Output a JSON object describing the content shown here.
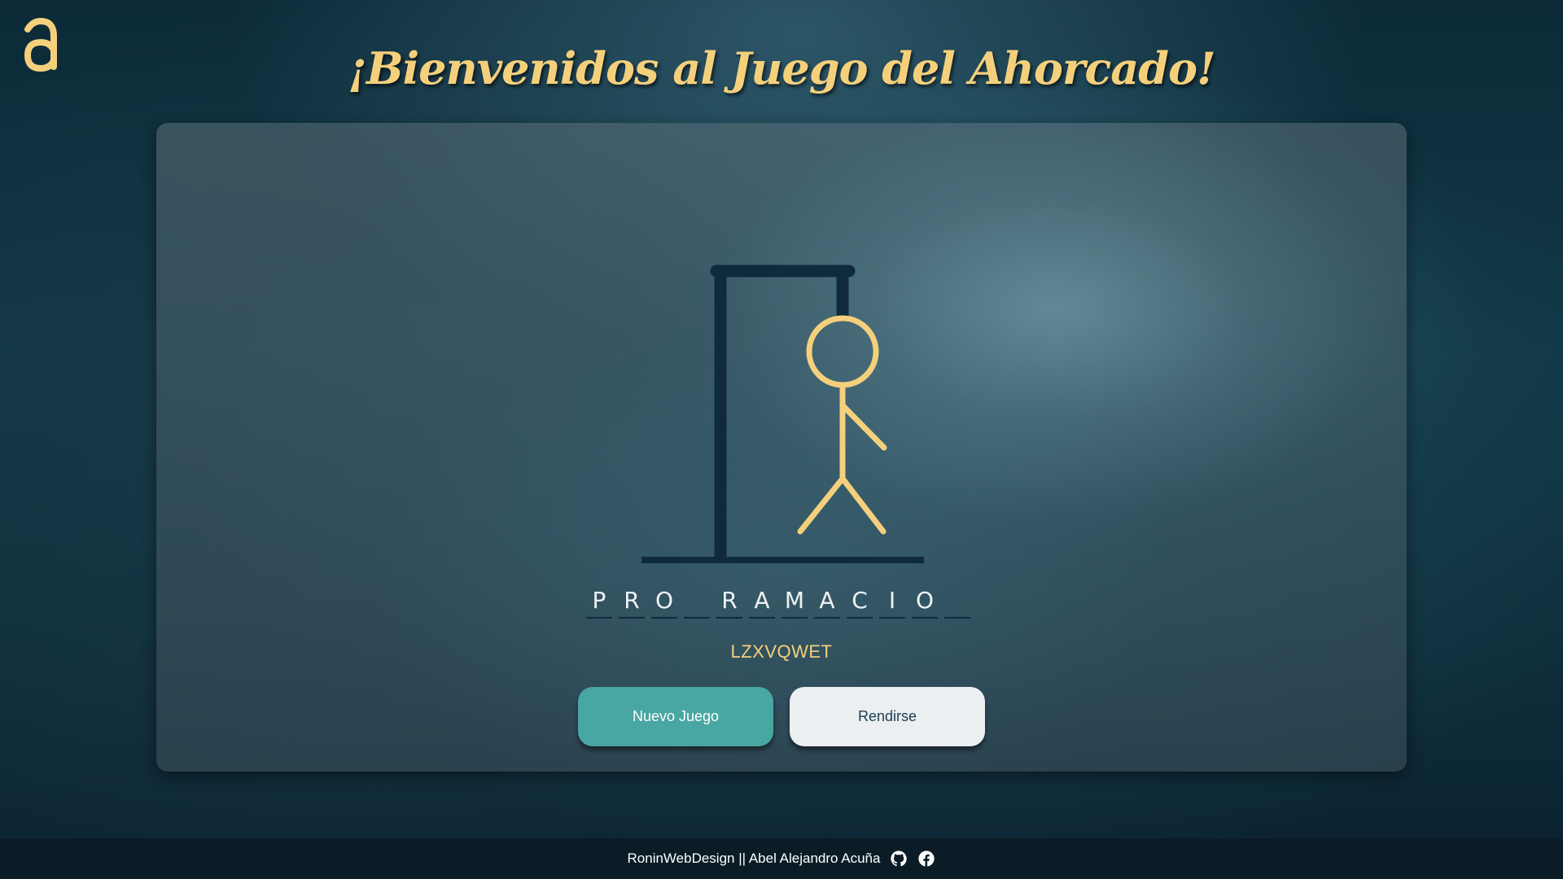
{
  "header": {
    "logo_icon": "letter-a-logo-icon",
    "title": "¡Bienvenidos al Juego del Ahorcado!"
  },
  "game": {
    "word_slots": [
      "P",
      "R",
      "O",
      "",
      "R",
      "A",
      "M",
      "A",
      "C",
      "I",
      "O",
      ""
    ],
    "wrong_letters": "LZXVQWET",
    "colors": {
      "gallows": "#0f2a3d",
      "hangman": "#f5d07c",
      "accent": "#48a6a3"
    }
  },
  "buttons": {
    "new_game_label": "Nuevo Juego",
    "give_up_label": "Rendirse"
  },
  "footer": {
    "text": "RoninWebDesign || Abel Alejandro Acuña",
    "icons": [
      "github-icon",
      "facebook-icon"
    ]
  }
}
